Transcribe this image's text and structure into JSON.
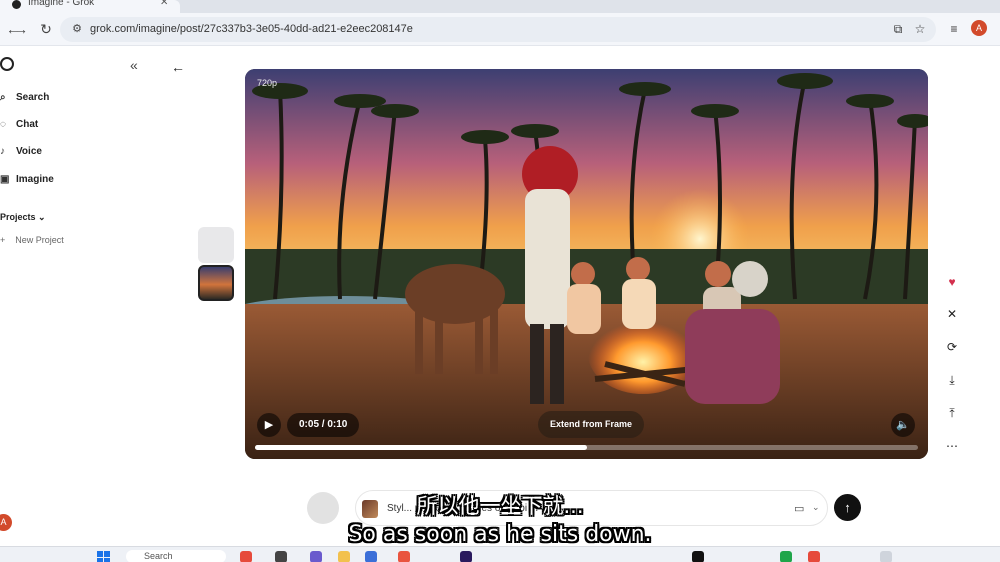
{
  "browser": {
    "tab_title": "Imagine - Grok",
    "url": "grok.com/imagine/post/27c337b3-3e05-40dd-ad21-e2eec208147e",
    "profile_initial": "A"
  },
  "sidebar": {
    "items": [
      {
        "label": "Search",
        "icon": "search-icon"
      },
      {
        "label": "Chat",
        "icon": "chat-icon"
      },
      {
        "label": "Voice",
        "icon": "voice-icon"
      },
      {
        "label": "Imagine",
        "icon": "imagine-icon"
      }
    ],
    "projects_label": "Projects",
    "new_project_label": "New Project",
    "user_initial": "A"
  },
  "video": {
    "quality": "720p",
    "time": "0:05 / 0:10",
    "progress": 0.5,
    "extend_label": "Extend from Frame"
  },
  "prompt": {
    "text": "Styl... reference images of Gebi ..."
  },
  "subtitles": {
    "zh": "所以他一坐下就...",
    "en": "So as soon as he sits down."
  },
  "taskbar": {
    "search_placeholder": "Search"
  },
  "colors": {
    "accent_red": "#d24a2b",
    "send_button": "#111111"
  }
}
